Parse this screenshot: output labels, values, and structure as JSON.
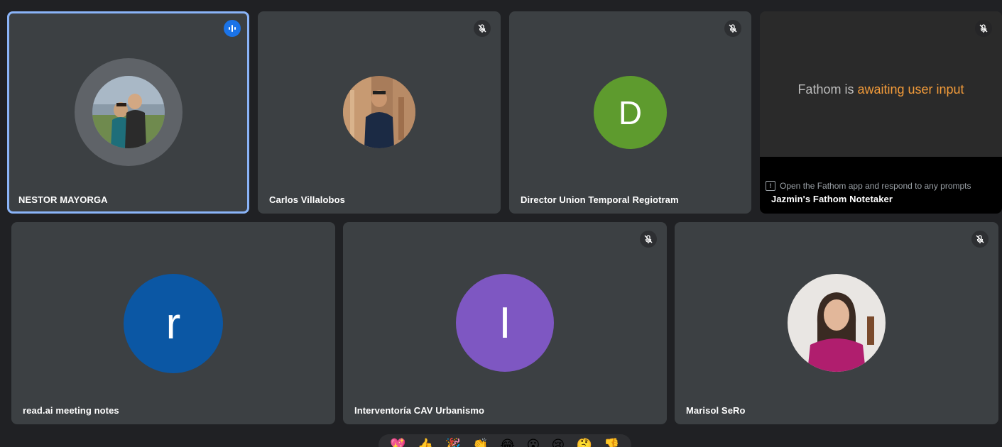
{
  "participants": {
    "nestor": {
      "name": "NESTOR MAYORGA",
      "status_icon": "speaking-audio-icon"
    },
    "carlos": {
      "name": "Carlos Villalobos",
      "status_icon": "mic-off-icon"
    },
    "director": {
      "name": "Director Union Temporal Regiotram",
      "initial": "D",
      "avatar_color": "#5e9b2e",
      "status_icon": "mic-off-icon"
    },
    "fathom": {
      "name": "Jazmin's Fathom Notetaker",
      "message_prefix": "Fathom is ",
      "message_highlight": "awaiting user input",
      "highlight_color": "#f29b3a",
      "hint": "Open the Fathom app and respond to any prompts",
      "hint_icon": "!",
      "status_icon": "mic-off-icon"
    },
    "readai": {
      "name": "read.ai meeting notes",
      "initial": "r",
      "avatar_color": "#0b57a4"
    },
    "interventoria": {
      "name": "Interventoría CAV Urbanismo",
      "initial": "I",
      "avatar_color": "#7e57c2",
      "status_icon": "mic-off-icon"
    },
    "marisol": {
      "name": "Marisol SeRo",
      "status_icon": "mic-off-icon"
    }
  },
  "colors": {
    "background": "#202124",
    "tile": "#3c4043",
    "speaking_outline": "#8ab4f8",
    "speaking_badge": "#1a73e8"
  },
  "reactions": [
    "💖",
    "👍",
    "🎉",
    "👏",
    "😂",
    "😮",
    "😢",
    "🤔",
    "👎"
  ]
}
